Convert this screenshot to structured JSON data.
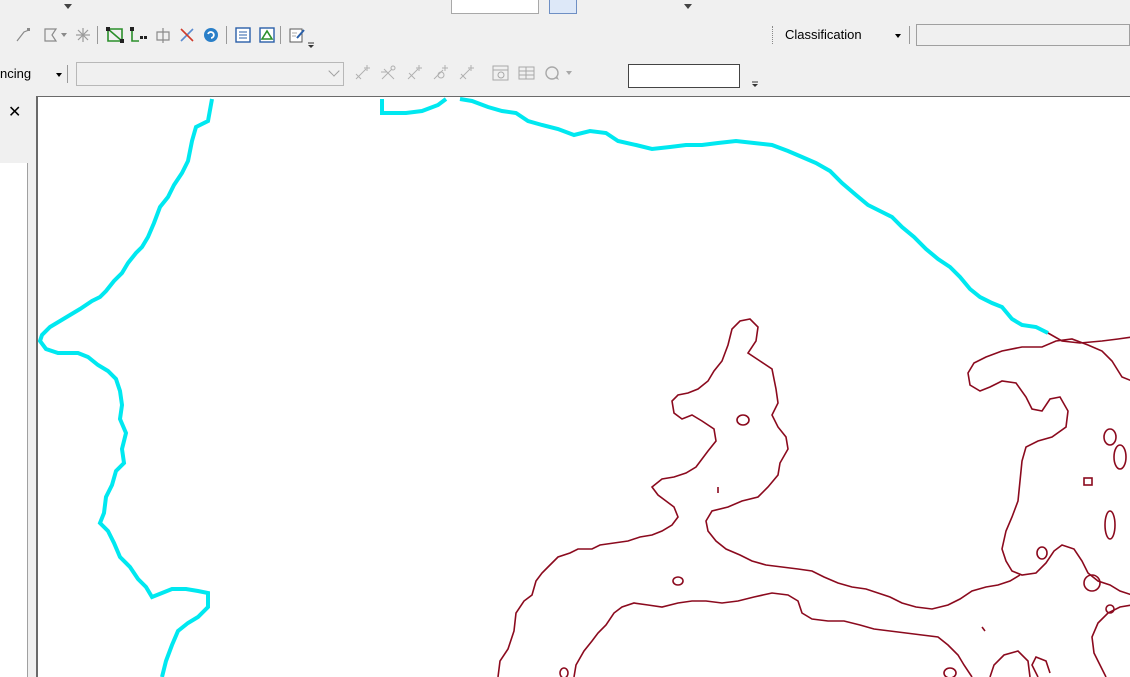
{
  "toolbars": {
    "classification": {
      "label": "Classification",
      "field_value": ""
    },
    "georeferencing": {
      "label": "ncing",
      "layer_value": "",
      "rotate_value": ""
    }
  },
  "left_pane": {
    "close_glyph": "✕"
  },
  "icons": {
    "editor_row": [
      "vertex-icon",
      "sketch-tool-icon",
      "explode-icon",
      "topology-edit-icon",
      "trace-icon",
      "split-icon",
      "intersect-icon",
      "rotate-icon",
      "attributes-icon",
      "sketch-properties-icon",
      "create-features-icon"
    ],
    "georef_row": [
      "add-control-point-icon",
      "auto-register-icon",
      "add-point-icon",
      "zoom-to-point-icon",
      "delete-point-icon",
      "view-link-table-icon",
      "link-table-icon",
      "rotate-icon"
    ]
  },
  "map": {
    "colors": {
      "water_boundary": "#00e8f0",
      "contour": "#8b0a1e",
      "background": "#ffffff"
    }
  }
}
